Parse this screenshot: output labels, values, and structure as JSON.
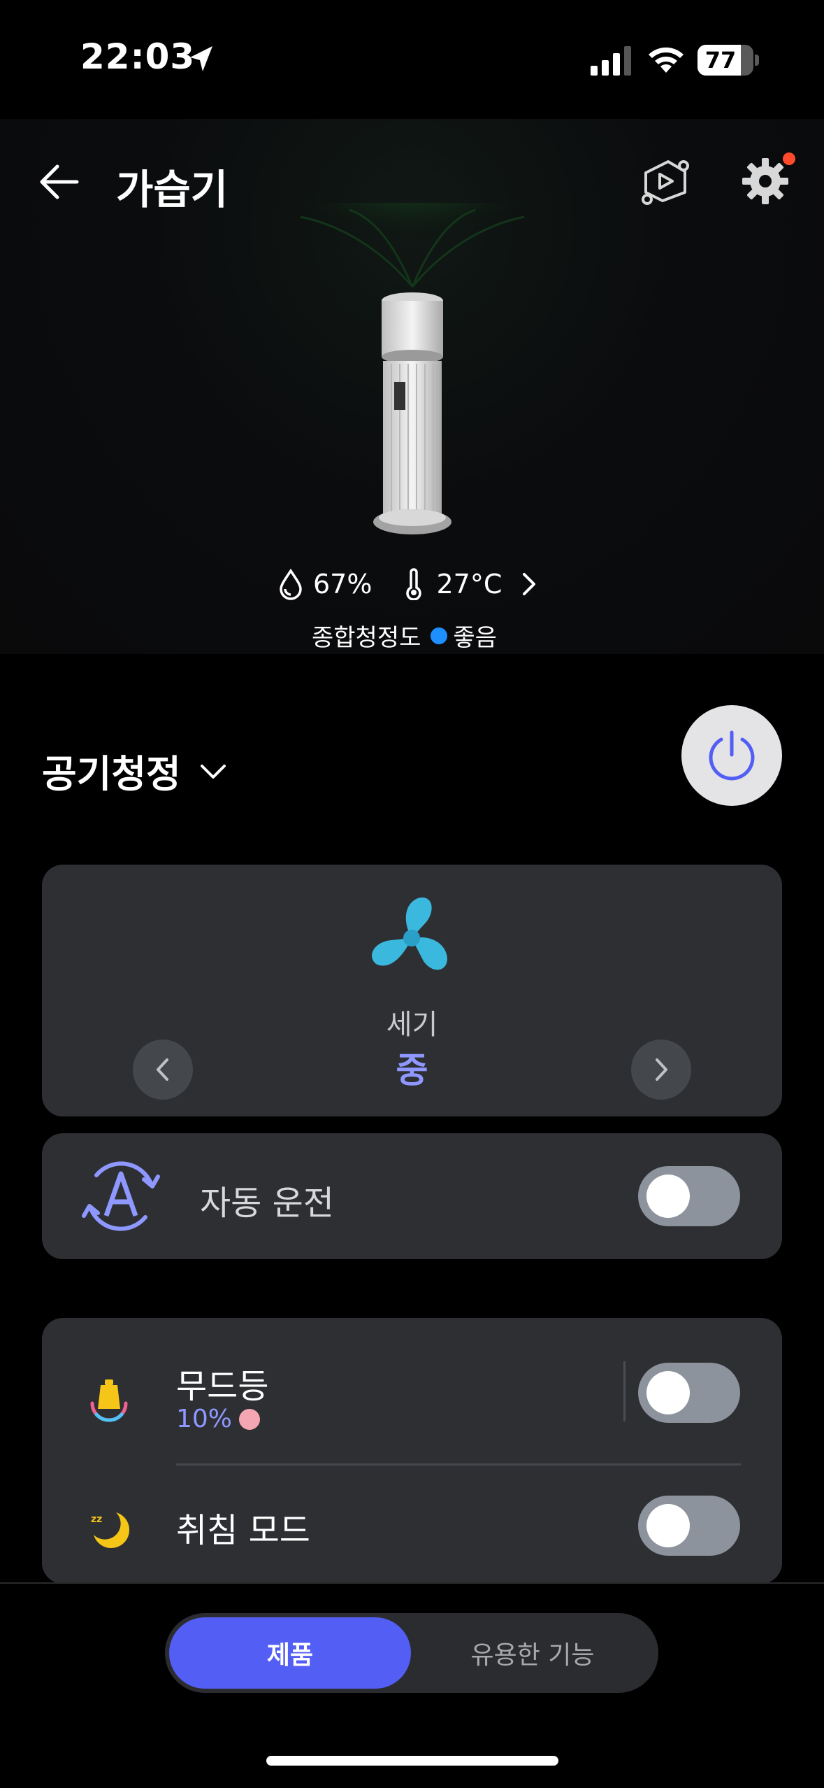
{
  "status": {
    "time": "22:03",
    "battery": "77",
    "battery_level": 0.77
  },
  "header": {
    "title": "가습기"
  },
  "metrics": {
    "humidity": "67%",
    "temperature": "27°C"
  },
  "air_quality": {
    "label": "종합청정도",
    "value": "좋음",
    "color": "#1e8fff"
  },
  "mode": {
    "selected": "공기청정"
  },
  "fan": {
    "label": "세기",
    "value": "중"
  },
  "auto": {
    "label": "자동 운전",
    "enabled": false
  },
  "mood_light": {
    "label": "무드등",
    "level": "10%",
    "color": "#f4a6b2",
    "enabled": false
  },
  "sleep_mode": {
    "label": "취침 모드",
    "enabled": false
  },
  "bottom_tabs": {
    "active": "제품",
    "inactive": "유용한 기능"
  },
  "colors": {
    "accent": "#535ef4",
    "accent_text": "#8e98ff",
    "card_bg": "#2d2f33"
  }
}
